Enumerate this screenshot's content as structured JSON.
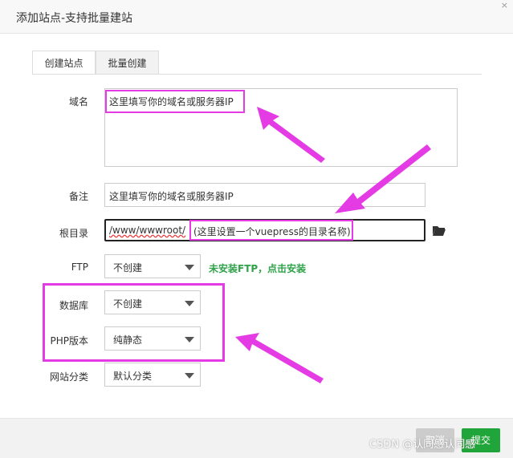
{
  "window": {
    "title": "添加站点-支持批量建站",
    "close_label": "×"
  },
  "tabs": [
    {
      "label": "创建站点",
      "active": true
    },
    {
      "label": "批量创建",
      "active": false
    }
  ],
  "form": {
    "domain": {
      "label": "域名",
      "value": "这里填写你的域名或服务器IP"
    },
    "remark": {
      "label": "备注",
      "value": "这里填写你的域名或服务器IP"
    },
    "root": {
      "label": "根目录",
      "value": "/www/wwwroot/",
      "note": "(这里设置一个vuepress的目录名称)"
    },
    "ftp": {
      "label": "FTP",
      "selected": "不创建",
      "hint": "未安装FTP，点击安装"
    },
    "database": {
      "label": "数据库",
      "selected": "不创建"
    },
    "php": {
      "label": "PHP版本",
      "selected": "纯静态"
    },
    "category": {
      "label": "网站分类",
      "selected": "默认分类"
    }
  },
  "footer": {
    "cancel_label": "取消",
    "submit_label": "提交"
  },
  "watermark": "CSDN @认同感认同感",
  "colors": {
    "highlight": "#e43be4",
    "submit": "#20a53a",
    "hint": "#2fa24a"
  }
}
